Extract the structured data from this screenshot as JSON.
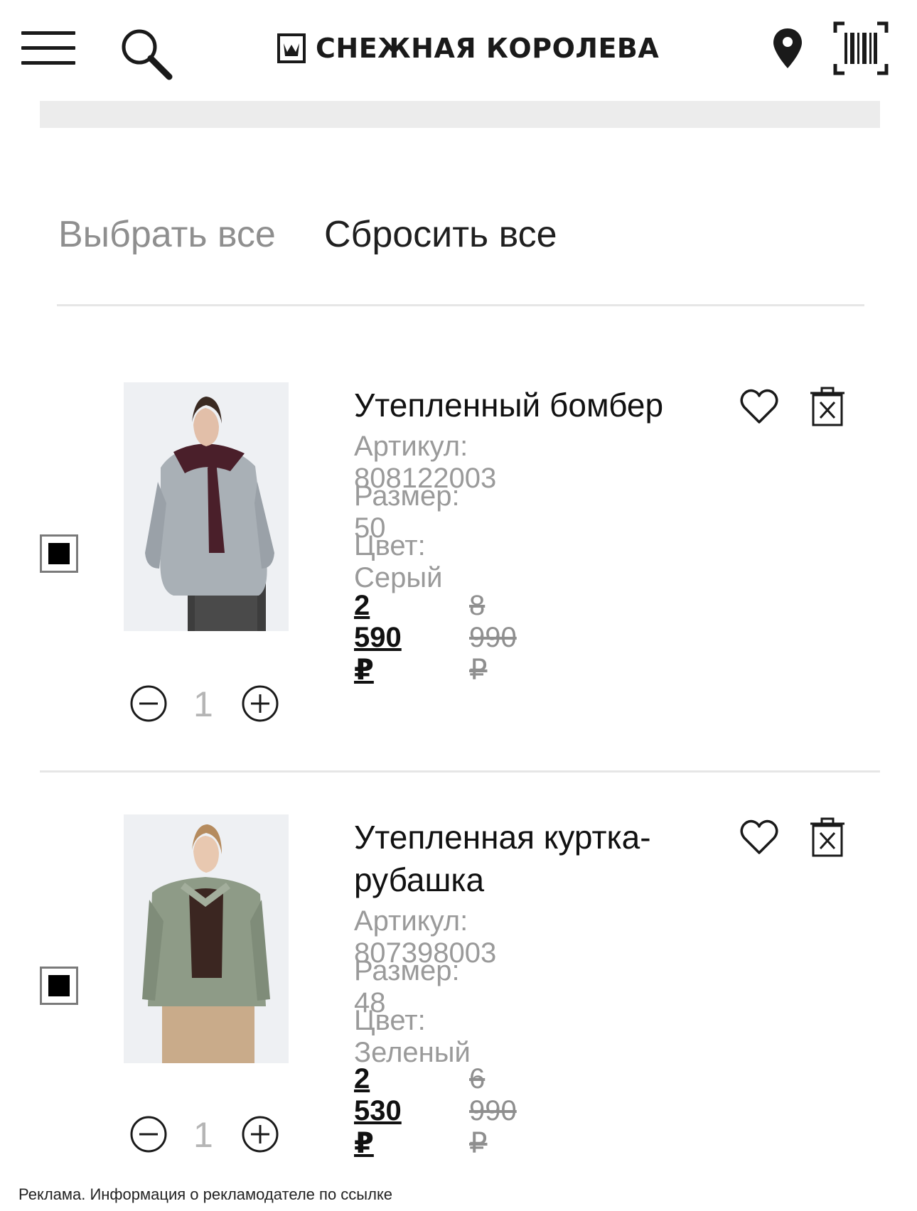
{
  "header": {
    "brand": "СНЕЖНАЯ КОРОЛЕВА",
    "icons": [
      "hamburger-menu-icon",
      "search-icon",
      "location-pin-icon",
      "barcode-scanner-icon"
    ]
  },
  "cart": {
    "select_all": "Выбрать все",
    "reset_all": "Сбросить все",
    "items": [
      {
        "title": "Утепленный бомбер",
        "article": "Артикул: 808122003",
        "size": "Размер: 50",
        "color": "Цвет: Серый",
        "price": "2 590 ₽",
        "old_price": "8 990 ₽",
        "quantity": "1",
        "checked": true
      },
      {
        "title": "Утепленная куртка-рубашка",
        "article": "Артикул: 807398003",
        "size": "Размер: 48",
        "color": "Цвет: Зеленый",
        "price": "2 530 ₽",
        "old_price": "6 990 ₽",
        "quantity": "1",
        "checked": true
      }
    ]
  },
  "footer": {
    "ad_note": "Реклама. Информация о рекламодателе по ссылке"
  },
  "colors": {
    "text": "#1a1a1a",
    "muted": "#9a9a9a",
    "divider": "#e6e6e6",
    "promo_bar": "#ececec"
  }
}
